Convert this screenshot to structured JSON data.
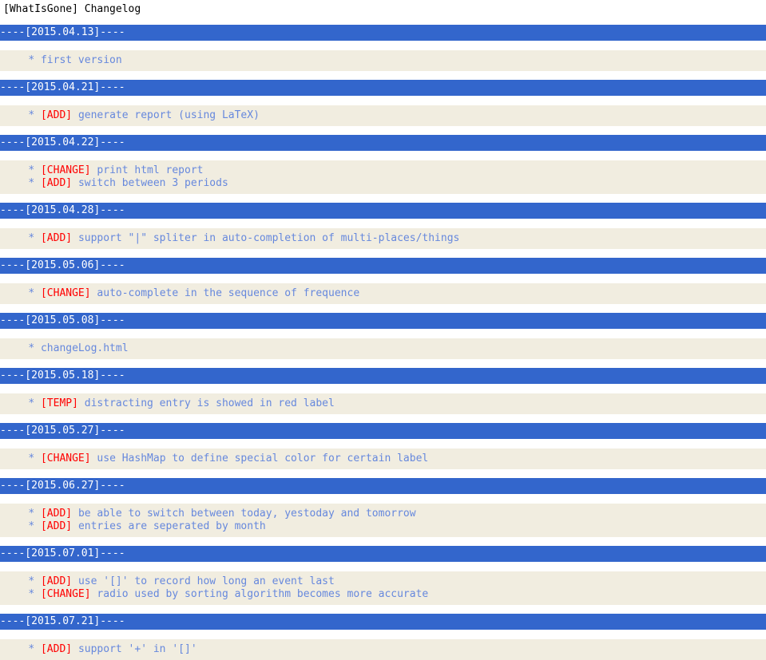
{
  "page": {
    "title": "[WhatIsGone] Changelog",
    "colors": {
      "release_bar_bg": "#3366CC",
      "release_bar_text": "#FFFFFF",
      "entry_bg": "#F1EDE0",
      "entry_text": "#6688DD",
      "tag_text": "#FF0000",
      "title_text": "#000000",
      "page_bg": "#FFFFFF"
    }
  },
  "releases": [
    {
      "header": "----[2015.04.13]----",
      "date": "2015.04.13",
      "entries": [
        {
          "bullet": "*",
          "tag": "",
          "text": "first version"
        }
      ]
    },
    {
      "header": "----[2015.04.21]----",
      "date": "2015.04.21",
      "entries": [
        {
          "bullet": "*",
          "tag": "[ADD]",
          "text": "generate report (using LaTeX)"
        }
      ]
    },
    {
      "header": "----[2015.04.22]----",
      "date": "2015.04.22",
      "entries": [
        {
          "bullet": "*",
          "tag": "[CHANGE]",
          "text": "print html report"
        },
        {
          "bullet": "*",
          "tag": "[ADD]",
          "text": "switch between 3 periods"
        }
      ]
    },
    {
      "header": "----[2015.04.28]----",
      "date": "2015.04.28",
      "entries": [
        {
          "bullet": "*",
          "tag": "[ADD]",
          "text": "support \"|\" spliter in auto-completion of multi-places/things"
        }
      ]
    },
    {
      "header": "----[2015.05.06]----",
      "date": "2015.05.06",
      "entries": [
        {
          "bullet": "*",
          "tag": "[CHANGE]",
          "text": "auto-complete in the sequence of frequence"
        }
      ]
    },
    {
      "header": "----[2015.05.08]----",
      "date": "2015.05.08",
      "entries": [
        {
          "bullet": "*",
          "tag": "",
          "text": "changeLog.html"
        }
      ]
    },
    {
      "header": "----[2015.05.18]----",
      "date": "2015.05.18",
      "entries": [
        {
          "bullet": "*",
          "tag": "[TEMP]",
          "text": "distracting entry is showed in red label"
        }
      ]
    },
    {
      "header": "----[2015.05.27]----",
      "date": "2015.05.27",
      "entries": [
        {
          "bullet": "*",
          "tag": "[CHANGE]",
          "text": "use HashMap to define special color for certain label"
        }
      ]
    },
    {
      "header": "----[2015.06.27]----",
      "date": "2015.06.27",
      "entries": [
        {
          "bullet": "*",
          "tag": "[ADD]",
          "text": "be able to switch between today, yestoday and tomorrow"
        },
        {
          "bullet": "*",
          "tag": "[ADD]",
          "text": "entries are seperated by month"
        }
      ]
    },
    {
      "header": "----[2015.07.01]----",
      "date": "2015.07.01",
      "entries": [
        {
          "bullet": "*",
          "tag": "[ADD]",
          "text": "use '[]' to record how long an event last"
        },
        {
          "bullet": "*",
          "tag": "[CHANGE]",
          "text": "radio used by sorting algorithm becomes more accurate"
        }
      ]
    },
    {
      "header": "----[2015.07.21]----",
      "date": "2015.07.21",
      "entries": [
        {
          "bullet": "*",
          "tag": "[ADD]",
          "text": "support '+' in '[]'"
        }
      ]
    }
  ]
}
